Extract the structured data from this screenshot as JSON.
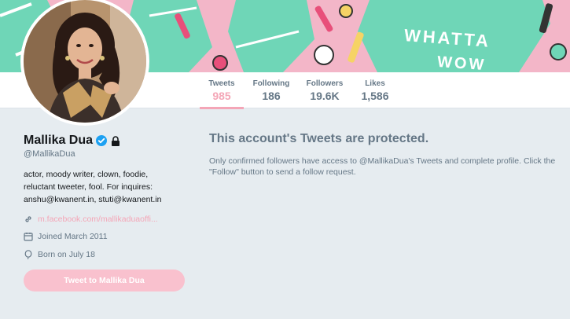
{
  "banner": {
    "line1": "WHATTA",
    "line2": "WOW"
  },
  "colors": {
    "accent": "#f4a6b7",
    "banner_pink": "#f3b6c8",
    "banner_teal": "#6fd6b7",
    "page_bg": "#e6ecf0",
    "verified": "#1da1f2"
  },
  "nav": {
    "stats": [
      {
        "label": "Tweets",
        "value": "985",
        "active": true
      },
      {
        "label": "Following",
        "value": "186",
        "active": false
      },
      {
        "label": "Followers",
        "value": "19.6K",
        "active": false
      },
      {
        "label": "Likes",
        "value": "1,586",
        "active": false
      }
    ]
  },
  "profile": {
    "name": "Mallika Dua",
    "handle": "@MallikaDua",
    "bio": "actor, moody writer, clown, foodie, reluctant tweeter, fool. For inquires: anshu@kwanent.in, stuti@kwanent.in",
    "link": "m.facebook.com/mallikaduaoffi...",
    "joined": "Joined March 2011",
    "born": "Born on July 18",
    "tweet_to_label": "Tweet to Mallika Dua",
    "icons": [
      "verified-icon",
      "lock-icon",
      "link-icon",
      "calendar-icon",
      "balloon-icon"
    ]
  },
  "protected": {
    "title": "This account's Tweets are protected.",
    "description": "Only confirmed followers have access to @MallikaDua's Tweets and complete profile. Click the \"Follow\" button to send a follow request."
  }
}
